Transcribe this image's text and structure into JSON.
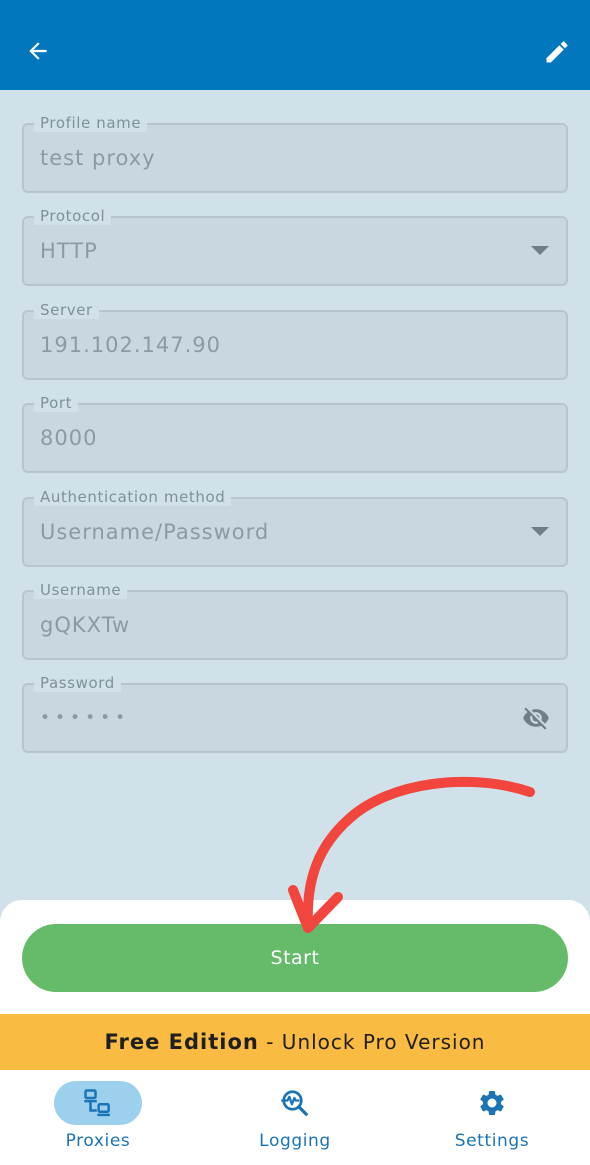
{
  "app_bar": {
    "back_icon": "arrow-left-icon",
    "edit_icon": "pencil-icon"
  },
  "form": {
    "profile_name": {
      "label": "Profile name",
      "value": "test proxy"
    },
    "protocol": {
      "label": "Protocol",
      "value": "HTTP",
      "icon": "dropdown-arrow-icon"
    },
    "server": {
      "label": "Server",
      "value": "191.102.147.90"
    },
    "port": {
      "label": "Port",
      "value": "8000"
    },
    "auth_method": {
      "label": "Authentication method",
      "value": "Username/Password",
      "icon": "dropdown-arrow-icon"
    },
    "username": {
      "label": "Username",
      "value": "gQKXTw"
    },
    "password": {
      "label": "Password",
      "value": "••••••",
      "icon": "eye-off-icon"
    }
  },
  "start_button": {
    "label": "Start"
  },
  "promo": {
    "bold": "Free Edition",
    "rest": " - Unlock Pro Version"
  },
  "nav": {
    "items": [
      {
        "label": "Proxies",
        "icon": "network-computers-icon",
        "active": true
      },
      {
        "label": "Logging",
        "icon": "search-monitoring-icon",
        "active": false
      },
      {
        "label": "Settings",
        "icon": "gear-icon",
        "active": false
      }
    ]
  },
  "colors": {
    "app_bar": "#0277bd",
    "start_button": "#66bb6a",
    "promo_banner": "#f9bb42",
    "nav_accent": "#1a74b5",
    "annotation_arrow": "#f1453d"
  }
}
